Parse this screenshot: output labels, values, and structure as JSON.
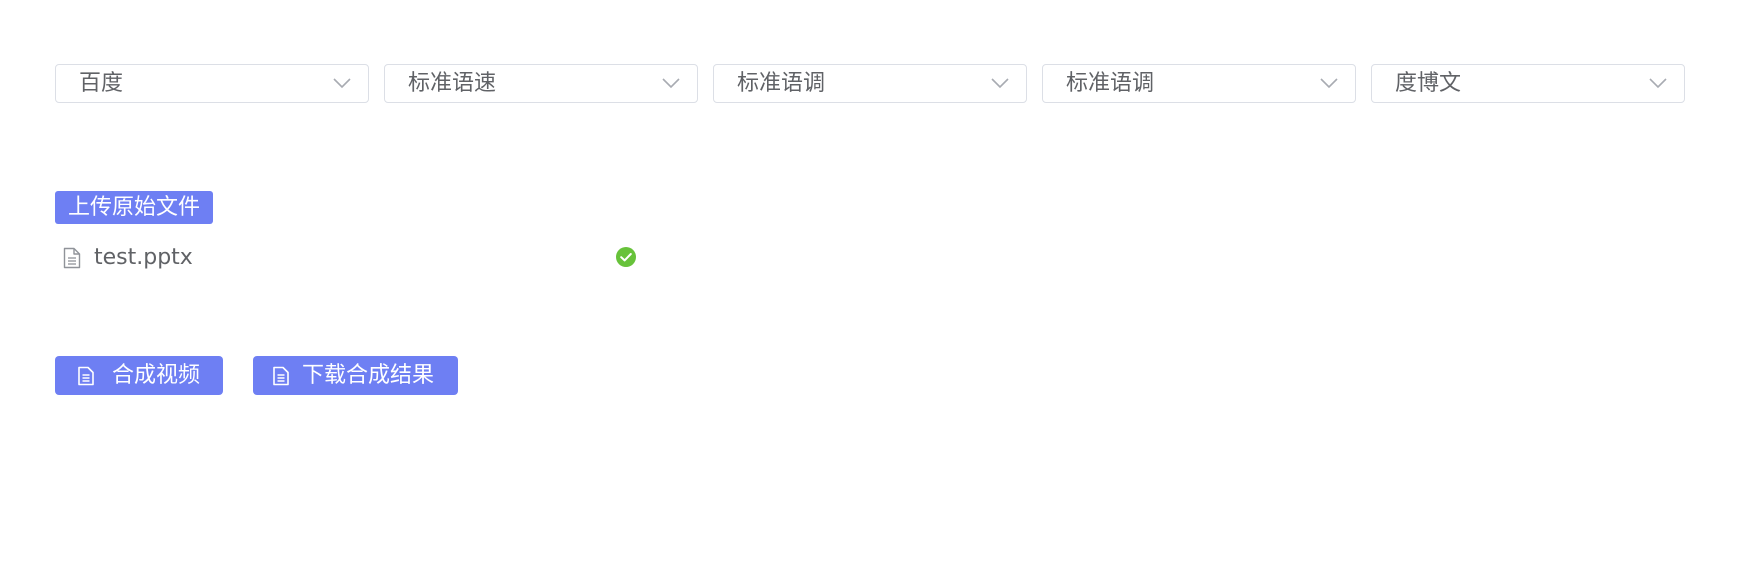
{
  "selects": [
    {
      "value": "百度"
    },
    {
      "value": "标准语速"
    },
    {
      "value": "标准语调"
    },
    {
      "value": "标准语调"
    },
    {
      "value": "度博文"
    }
  ],
  "upload": {
    "button_label": "上传原始文件",
    "file": {
      "name": "test.pptx",
      "status_icon": "success-check-icon"
    }
  },
  "actions": {
    "synthesize_label": "合成视频",
    "download_label": "下载合成结果"
  },
  "colors": {
    "primary": "#6e7ff3",
    "success": "#67c23a",
    "border": "#dcdfe6",
    "text": "#606266"
  }
}
